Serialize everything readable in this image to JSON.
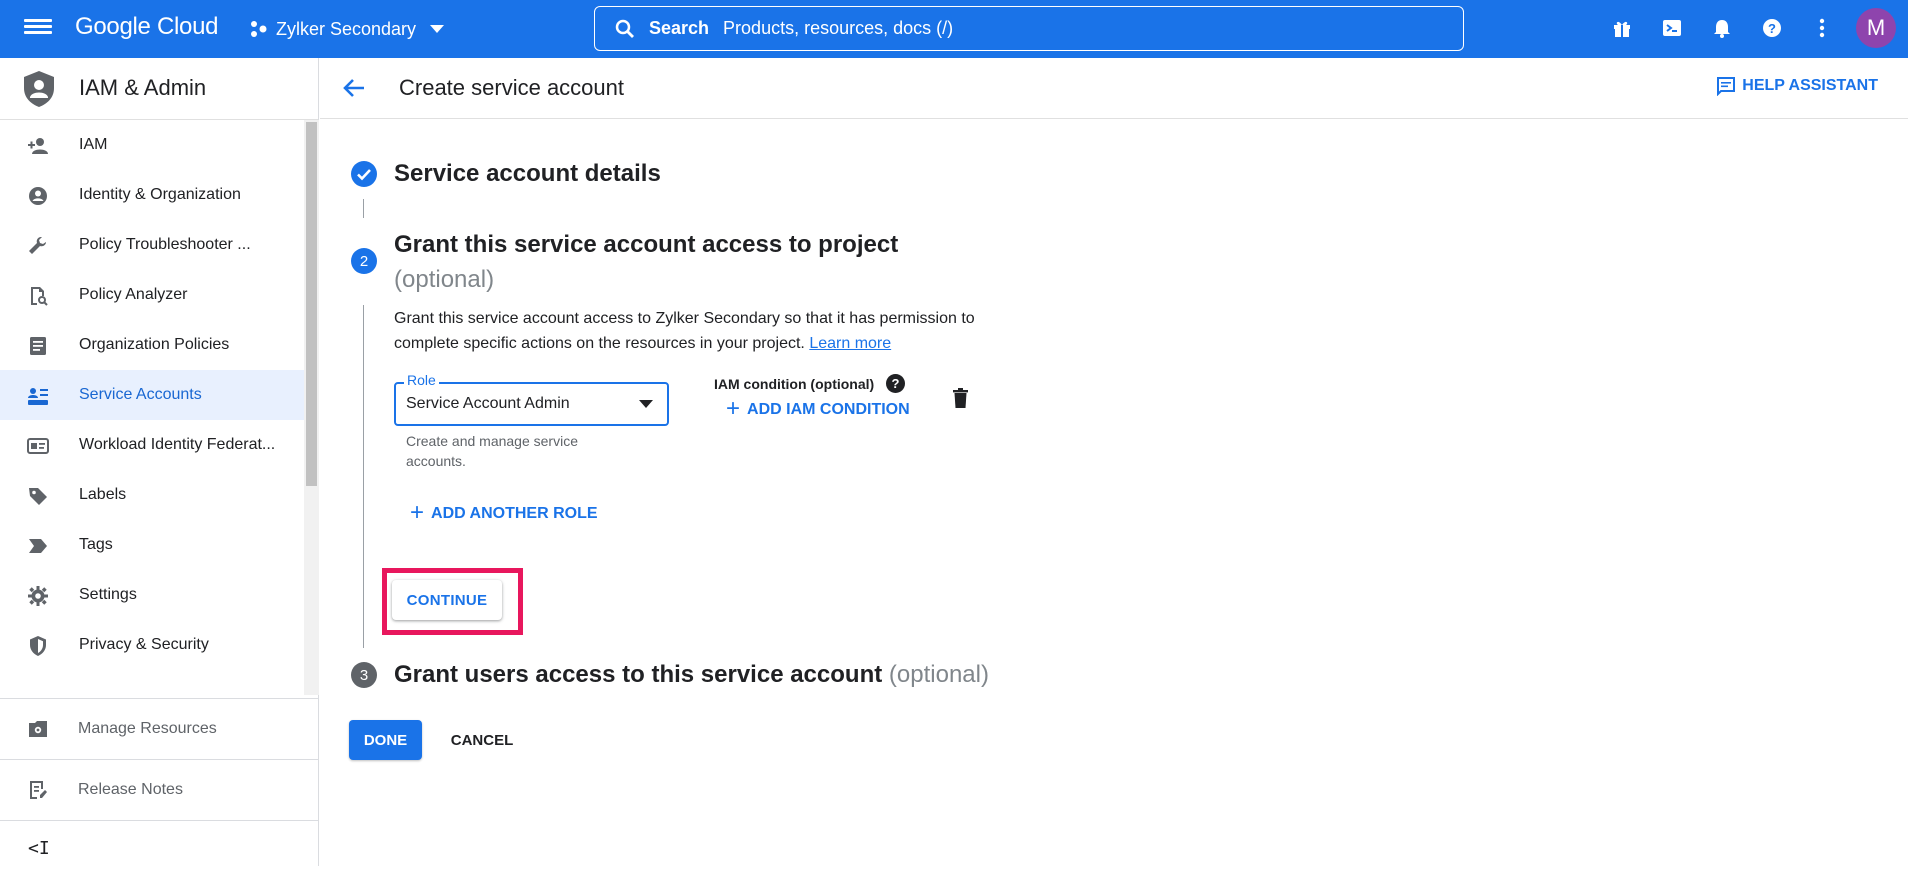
{
  "topbar": {
    "logo": "Google Cloud",
    "project_name": "Zylker Secondary",
    "search_label": "Search",
    "search_placeholder": "Products, resources, docs (/)",
    "avatar_initial": "M"
  },
  "sidebar": {
    "title": "IAM & Admin",
    "items": [
      {
        "label": "IAM",
        "icon": "person-add-icon"
      },
      {
        "label": "Identity & Organization",
        "icon": "account-circle-icon"
      },
      {
        "label": "Policy Troubleshooter ...",
        "icon": "wrench-icon"
      },
      {
        "label": "Policy Analyzer",
        "icon": "document-search-icon"
      },
      {
        "label": "Organization Policies",
        "icon": "document-icon"
      },
      {
        "label": "Service Accounts",
        "icon": "service-account-icon",
        "active": true
      },
      {
        "label": "Workload Identity Federat...",
        "icon": "id-card-icon"
      },
      {
        "label": "Labels",
        "icon": "label-icon"
      },
      {
        "label": "Tags",
        "icon": "tag-icon"
      },
      {
        "label": "Settings",
        "icon": "gear-icon"
      },
      {
        "label": "Privacy & Security",
        "icon": "shield-icon"
      }
    ],
    "bottom": {
      "manage_resources": "Manage Resources",
      "release_notes": "Release Notes",
      "collapse": "<I"
    }
  },
  "header": {
    "title": "Create service account",
    "help": "HELP ASSISTANT"
  },
  "steps": {
    "step1_title": "Service account details",
    "step2_number": "2",
    "step2_title": "Grant this service account access to project",
    "step2_optional": "(optional)",
    "step2_desc": "Grant this service account access to Zylker Secondary so that it has permission to complete specific actions on the resources in your project.",
    "learn_more": "Learn more",
    "role_label": "Role",
    "role_value": "Service Account Admin",
    "role_help": "Create and manage service accounts.",
    "iam_condition_label": "IAM condition (optional)",
    "add_iam_condition": "ADD IAM CONDITION",
    "add_another_role": "ADD ANOTHER ROLE",
    "continue": "CONTINUE",
    "step3_number": "3",
    "step3_title": "Grant users access to this service account",
    "step3_optional": "(optional)"
  },
  "actions": {
    "done": "DONE",
    "cancel": "CANCEL"
  },
  "colors": {
    "brand_blue": "#1a73e8",
    "highlight": "#e8175d",
    "avatar": "#8e44ad"
  }
}
